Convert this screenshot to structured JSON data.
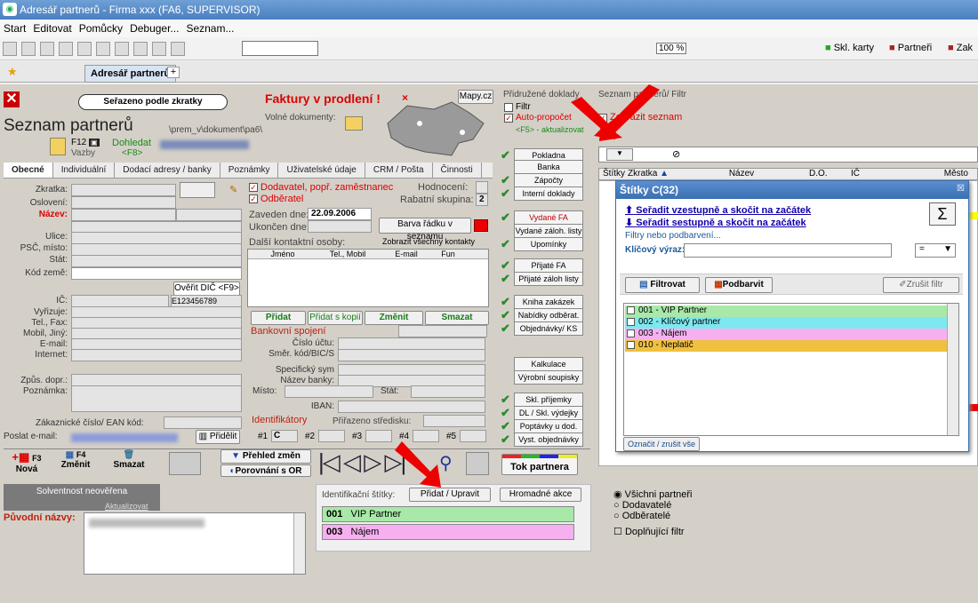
{
  "window": {
    "title": "Adresář partnerů - Firma xxx (FA6, SUPERVISOR)"
  },
  "menu": [
    "Start",
    "Editovat",
    "Pomůcky",
    "Debuger...",
    "Seznam..."
  ],
  "toolbar": {
    "zoom": "100 %",
    "links": [
      "Skl. karty",
      "Partneři",
      "Zak"
    ]
  },
  "doc_tab": "Adresář partnerů",
  "header": {
    "sort_badge": "Seřazeno podle zkratky",
    "overdue": "Faktury v prodlení !",
    "map_button": "Mapy.cz",
    "title": "Seznam partnerů",
    "path": "\\prem_v\\dokument\\pa6\\",
    "free_docs": "Volné dokumenty:",
    "f12": "F12",
    "dohledat": "Dohledat",
    "f8": "<F8>",
    "vazby": "Vazby"
  },
  "tabs": [
    "Obecné",
    "Individuální",
    "Dodací adresy / banky",
    "Poznámky",
    "Uživatelské údaje",
    "CRM / Pošta",
    "Činnosti"
  ],
  "left_labels": [
    "Zkratka:",
    "Oslovení:",
    "Název:",
    "Ulice:",
    "PSČ, místo:",
    "Stát:",
    "Kód země:",
    "IČ:",
    "Vyřizuje:",
    "Tel., Fax:",
    "Mobil, Jiný:",
    "E-mail:",
    "Internet:",
    "Způs. dopr.:",
    "Poznámka:"
  ],
  "ean_label": "Zákaznické číslo/ EAN kód:",
  "email_label": "Poslat e-mail:",
  "pridelit": "Přidělit",
  "dic_button": "Ověřit DIČ <F9>",
  "ic_value": "E123456789",
  "middle": {
    "supplier": "Dodavatel, popř. zaměstnanec",
    "customer": "Odběratel",
    "rating": "Hodnocení:",
    "discount": "Rabatní skupina:",
    "discount_val": "2",
    "since_lbl": "Zaveden dne:",
    "since": "22.09.2006",
    "ended": "Ukončen dne:",
    "row_color": "Barva řádku v seznamu",
    "contacts": "Další kontaktní osoby:",
    "show_all": "Zobrazit všechny kontakty",
    "cols": [
      "Jméno",
      "Tel., Mobil",
      "E-mail",
      "Fun"
    ],
    "actions": [
      "Přidat",
      "Přidat s kopií",
      "Změnit",
      "Smazat"
    ],
    "bank_title": "Bankovní spojení",
    "bank_labels": [
      "Číslo účtu:",
      "Směr. kód/BIC/S",
      "Specifický sym",
      "Název banky:",
      "Místo:",
      "Stát:",
      "IBAN:"
    ],
    "ident": "Identifikátory",
    "stredisko": "Přiřazeno středisku:",
    "ids": [
      "#1",
      "C",
      "#2",
      "#3",
      "#4",
      "#5"
    ]
  },
  "side_top": {
    "title": "Přidružené doklady",
    "filtr": "Filtr",
    "auto": "Auto-propočet",
    "refresh": "<F5> - aktualizovat"
  },
  "side_buttons": [
    "Pokladna",
    "Banka",
    "Zápočty",
    "Interní doklady",
    "Vydané FA",
    "Vydané záloh. listy",
    "Upomínky",
    "Přijaté FA",
    "Přijaté záloh listy",
    "Kniha zakázek",
    "Nabídky odběrat.",
    "Objednávky/ KS",
    "Kalkulace",
    "Výrobní soupisky",
    "Skl. příjemky",
    "DL / Skl. výdejky",
    "Poptávky u dod.",
    "Vyst. objednávky"
  ],
  "right": {
    "title": "Seznam partnerů/ Filtr",
    "show_list": "Zobrazit seznam",
    "cols": [
      "Štítky",
      "Zkratka",
      "Název",
      "D.",
      "O.",
      "IČ",
      "Město"
    ]
  },
  "popup": {
    "title": "Štítky C(32)",
    "sort_asc": "Seřadit vzestupně a skočit na začátek",
    "sort_desc": "Seřadit sestupně a skočit na začátek",
    "filters": "Filtry nebo podbarvení...",
    "keyword": "Klíčový výraz:",
    "op": "=",
    "filter_btn": "Filtrovat",
    "color_btn": "Podbarvit",
    "cancel_btn": "Zrušit filtr",
    "items": [
      {
        "code": "001",
        "name": "VIP Partner",
        "color": "#a8e8a8"
      },
      {
        "code": "002",
        "name": "Klíčový partner",
        "color": "#7ee8f0"
      },
      {
        "code": "003",
        "name": "Nájem",
        "color": "#f6b0f0"
      },
      {
        "code": "010",
        "name": "Neplatič",
        "color": "#f0c040"
      }
    ],
    "mark": "Označit / zrušit vše"
  },
  "bottom": {
    "nova": "Nová",
    "zmenit": "Změnit",
    "smazat": "Smazat",
    "f3": "F3",
    "f4": "F4",
    "prehled": "Přehled změn",
    "porovnani": "Porovnání s OR",
    "tok": "Tok partnera",
    "solvency": "Solventnost neověřena",
    "update": "Aktualizovat",
    "old_names": "Původní názvy:",
    "ident_label": "Identifikační štítky:",
    "add_edit": "Přidat / Upravit",
    "bulk": "Hromadné akce",
    "tags": [
      {
        "code": "001",
        "name": "VIP Partner",
        "color": "#a8e8a8"
      },
      {
        "code": "003",
        "name": "Nájem",
        "color": "#f6b0f0"
      }
    ],
    "radios": [
      "Všichni partneři",
      "Dodavatelé",
      "Odběratelé"
    ],
    "extra": "Doplňující filtr"
  }
}
